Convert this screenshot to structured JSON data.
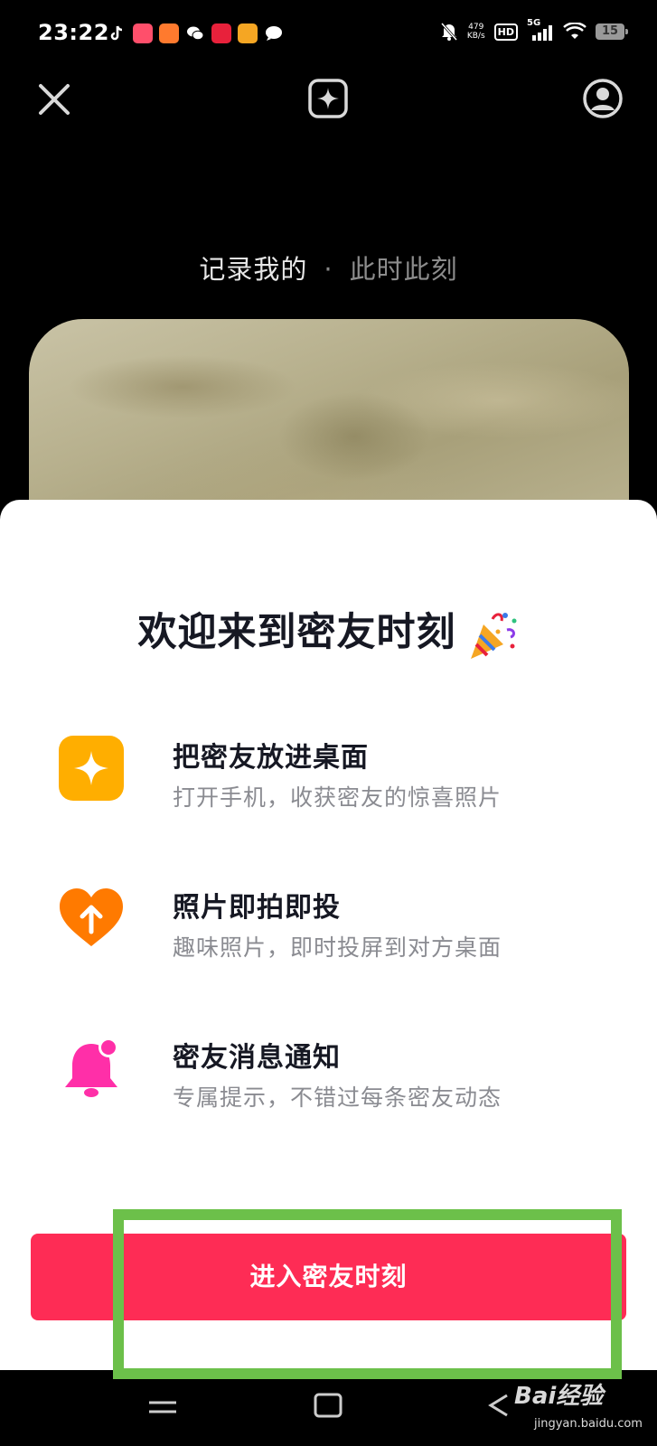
{
  "status_bar": {
    "time": "23:22",
    "network_speed_value": "479",
    "network_speed_unit": "KB/s",
    "hd_label": "HD",
    "signal_label": "5G",
    "battery_level": "15"
  },
  "tagline": {
    "first": "记录我的",
    "separator": "·",
    "second": "此时此刻"
  },
  "sheet": {
    "title": "欢迎来到密友时刻",
    "title_emoji": "party-popper-icon",
    "features": [
      {
        "icon": "sparkle-icon",
        "title": "把密友放进桌面",
        "description": "打开手机，收获密友的惊喜照片"
      },
      {
        "icon": "heart-upload-icon",
        "title": "照片即拍即投",
        "description": "趣味照片，即时投屏到对方桌面"
      },
      {
        "icon": "bell-icon",
        "title": "密友消息通知",
        "description": "专属提示，不错过每条密友动态"
      }
    ],
    "enter_button_label": "进入密友时刻"
  },
  "watermark": {
    "main": "Bai经验",
    "sub": "jingyan.baidu.com"
  },
  "colors": {
    "primary_button": "#fe2c55",
    "sparkle_icon_bg": "#ffae00",
    "heart_icon": "#ff7a00",
    "bell_icon": "#ff2fa8",
    "annotation_frame": "#6cc04a"
  }
}
